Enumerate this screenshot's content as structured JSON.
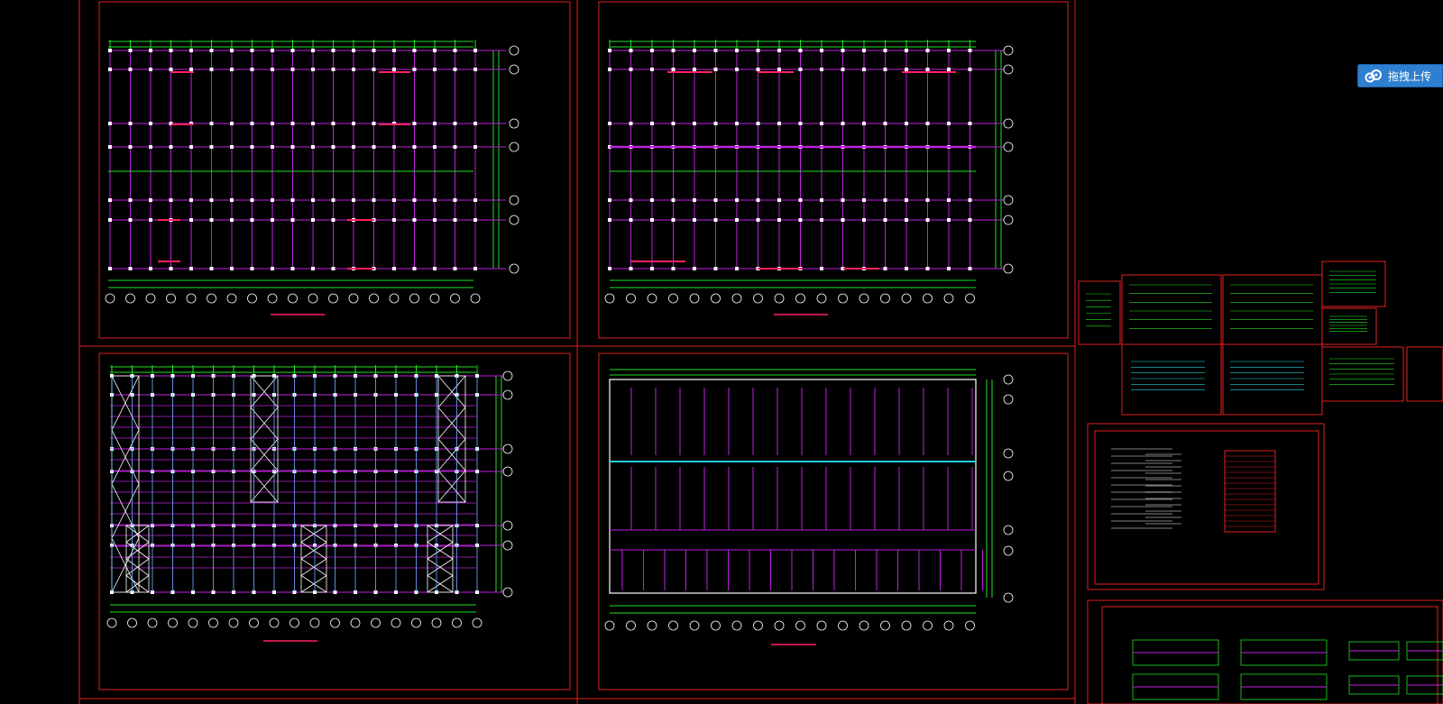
{
  "upload_button": {
    "label": "拖拽上传",
    "icon": "cloud-upload-icon"
  },
  "colors": {
    "background": "#000000",
    "sheet_border": "#e02020",
    "grid_lines": "#c020e0",
    "dimension_lines": "#20e020",
    "bubbles": "#ffffff",
    "bracing": "#ffffff",
    "highlight_beam": "#ff2060",
    "cyan_members": "#20d0e0",
    "upload_button": "#2f7fd0"
  }
}
